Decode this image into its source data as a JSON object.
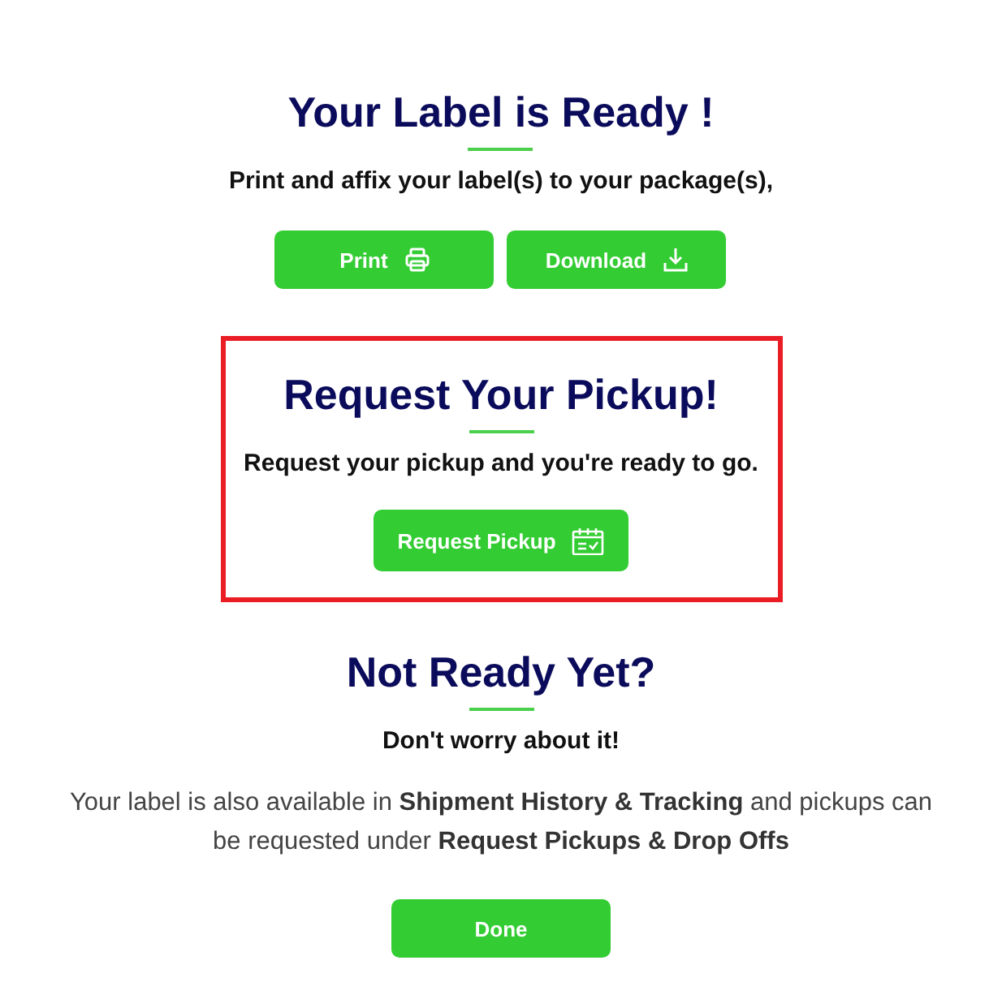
{
  "label_ready": {
    "title": "Your Label is Ready !",
    "subtitle": "Print and affix your label(s) to your package(s),",
    "buttons": [
      {
        "label": "Print"
      },
      {
        "label": "Download"
      }
    ]
  },
  "pickup": {
    "title": "Request Your Pickup!",
    "subtitle": "Request your pickup and you're ready to go.",
    "button": {
      "label": "Request Pickup"
    }
  },
  "not_ready": {
    "title": "Not Ready Yet?",
    "subtitle": "Don't worry about it!",
    "text": "Your label is also available in **Shipment History & Tracking** and pickups can be requested under **Request Pickups & Drop Offs**",
    "button": {
      "label": "Done"
    }
  }
}
